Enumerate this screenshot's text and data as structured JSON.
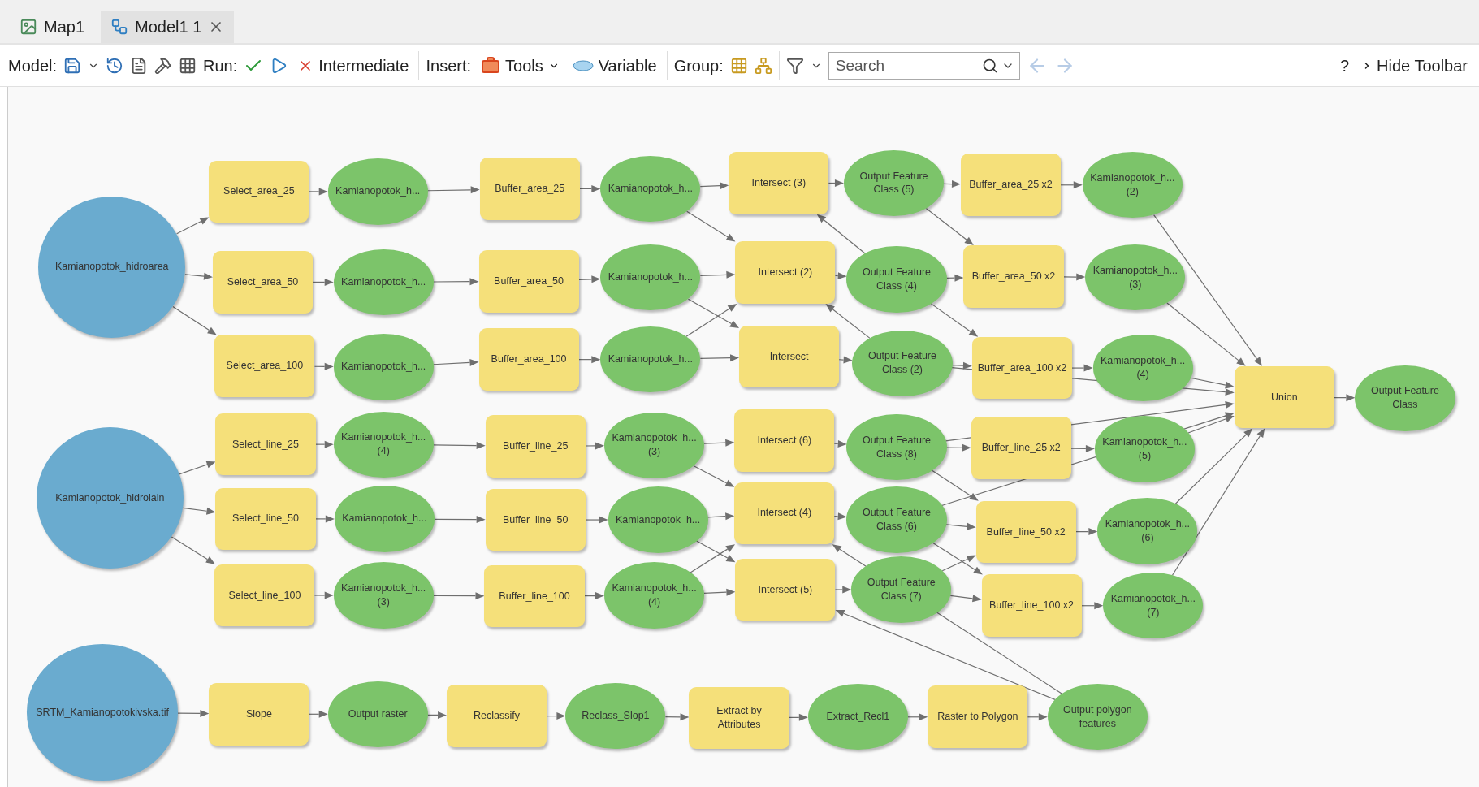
{
  "tabs": [
    {
      "label": "Map1",
      "selected": false
    },
    {
      "label": "Model1 1",
      "selected": true
    }
  ],
  "toolbar": {
    "model_label": "Model:",
    "run_label": "Run:",
    "intermediate": "Intermediate",
    "insert_label": "Insert:",
    "tools": "Tools",
    "variable": "Variable",
    "group_label": "Group:",
    "search": {
      "placeholder": "Search"
    },
    "help": "?",
    "hide_toolbar": "Hide Toolbar"
  },
  "nodes": [
    {
      "label": "Kamianopotok_hidroarea",
      "kind": "data"
    },
    {
      "label": "Select_area_25",
      "kind": "tool"
    },
    {
      "label": "Kamianopotok_h...",
      "kind": "output"
    },
    {
      "label": "Buffer_area_25",
      "kind": "tool"
    },
    {
      "label": "Kamianopotok_h...",
      "kind": "output"
    },
    {
      "label": "Intersect (3)",
      "kind": "tool"
    },
    {
      "label": "Output Feature Class (5)",
      "kind": "output"
    },
    {
      "label": "Buffer_area_25 x2",
      "kind": "tool"
    },
    {
      "label": "Kamianopotok_h... (2)",
      "kind": "output"
    },
    {
      "label": "Select_area_50",
      "kind": "tool"
    },
    {
      "label": "Kamianopotok_h...",
      "kind": "output"
    },
    {
      "label": "Buffer_area_50",
      "kind": "tool"
    },
    {
      "label": "Kamianopotok_h...",
      "kind": "output"
    },
    {
      "label": "Intersect (2)",
      "kind": "tool"
    },
    {
      "label": "Output Feature Class (4)",
      "kind": "output"
    },
    {
      "label": "Buffer_area_50 x2",
      "kind": "tool"
    },
    {
      "label": "Kamianopotok_h... (3)",
      "kind": "output"
    },
    {
      "label": "Select_area_100",
      "kind": "tool"
    },
    {
      "label": "Kamianopotok_h...",
      "kind": "output"
    },
    {
      "label": "Buffer_area_100",
      "kind": "tool"
    },
    {
      "label": "Kamianopotok_h...",
      "kind": "output"
    },
    {
      "label": "Intersect",
      "kind": "tool"
    },
    {
      "label": "Output Feature Class (2)",
      "kind": "output"
    },
    {
      "label": "Buffer_area_100 x2",
      "kind": "tool"
    },
    {
      "label": "Kamianopotok_h... (4)",
      "kind": "output"
    },
    {
      "label": "Union",
      "kind": "tool"
    },
    {
      "label": "Output Feature Class",
      "kind": "output"
    },
    {
      "label": "Kamianopotok_hidrolain",
      "kind": "data"
    },
    {
      "label": "Select_line_25",
      "kind": "tool"
    },
    {
      "label": "Kamianopotok_h... (4)",
      "kind": "output"
    },
    {
      "label": "Buffer_line_25",
      "kind": "tool"
    },
    {
      "label": "Kamianopotok_h... (3)",
      "kind": "output"
    },
    {
      "label": "Intersect (6)",
      "kind": "tool"
    },
    {
      "label": "Output Feature Class (8)",
      "kind": "output"
    },
    {
      "label": "Buffer_line_25 x2",
      "kind": "tool"
    },
    {
      "label": "Kamianopotok_h... (5)",
      "kind": "output"
    },
    {
      "label": "Select_line_50",
      "kind": "tool"
    },
    {
      "label": "Kamianopotok_h...",
      "kind": "output"
    },
    {
      "label": "Buffer_line_50",
      "kind": "tool"
    },
    {
      "label": "Kamianopotok_h...",
      "kind": "output"
    },
    {
      "label": "Intersect (4)",
      "kind": "tool"
    },
    {
      "label": "Output Feature Class (6)",
      "kind": "output"
    },
    {
      "label": "Buffer_line_50 x2",
      "kind": "tool"
    },
    {
      "label": "Kamianopotok_h... (6)",
      "kind": "output"
    },
    {
      "label": "Select_line_100",
      "kind": "tool"
    },
    {
      "label": "Kamianopotok_h... (3)",
      "kind": "output"
    },
    {
      "label": "Buffer_line_100",
      "kind": "tool"
    },
    {
      "label": "Kamianopotok_h... (4)",
      "kind": "output"
    },
    {
      "label": "Intersect (5)",
      "kind": "tool"
    },
    {
      "label": "Output Feature Class (7)",
      "kind": "output"
    },
    {
      "label": "Buffer_line_100 x2",
      "kind": "tool"
    },
    {
      "label": "Kamianopotok_h... (7)",
      "kind": "output"
    },
    {
      "label": "SRTM_Kamianopotokivska.tif",
      "kind": "data"
    },
    {
      "label": "Slope",
      "kind": "tool"
    },
    {
      "label": "Output raster",
      "kind": "output"
    },
    {
      "label": "Reclassify",
      "kind": "tool"
    },
    {
      "label": "Reclass_Slop1",
      "kind": "output"
    },
    {
      "label": "Extract by Attributes",
      "kind": "tool"
    },
    {
      "label": "Extract_Recl1",
      "kind": "output"
    },
    {
      "label": "Raster to Polygon",
      "kind": "tool"
    },
    {
      "label": "Output polygon features",
      "kind": "output"
    }
  ]
}
